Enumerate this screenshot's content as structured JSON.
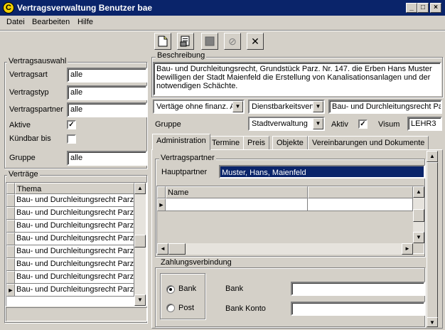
{
  "window": {
    "title": "Vertragsverwaltung Benutzer bae",
    "controls": {
      "minimize": "_",
      "maximize": "□",
      "close": "×"
    }
  },
  "menu": [
    "Datei",
    "Bearbeiten",
    "Hilfe"
  ],
  "toolbar": {
    "icons": [
      "new-document-icon",
      "save-document-icon",
      "stop-icon",
      "cancel-icon",
      "delete-icon"
    ],
    "glyph_delete": "✕",
    "glyph_cancel": "⊘"
  },
  "selection": {
    "title": "Vertragsauswahl",
    "fields": [
      {
        "label": "Vertragsart",
        "value": "alle"
      },
      {
        "label": "Vertragstyp",
        "value": "alle"
      },
      {
        "label": "Vertragspartner",
        "value": "alle"
      }
    ],
    "active_label": "Aktive",
    "active_checked": true,
    "cancelable_label": "Kündbar bis",
    "cancelable_checked": false,
    "group_label": "Gruppe",
    "group_value": "alle"
  },
  "contracts": {
    "title": "Verträge",
    "column": "Thema",
    "rows": [
      "Bau- und Durchleitungsrecht Parz.",
      "Bau- und Durchleitungsrecht Parz.",
      "Bau- und Durchleitungsrecht Parz.",
      "Bau- und Durchleitungsrecht Parz.",
      "Bau- und Durchleitungsrecht Parz.",
      "Bau- und Durchleitungsrecht Parz.",
      "Bau- und Durchleitungsrecht Parz.",
      "Bau- und Durchleitungsrecht Parz."
    ],
    "selected_index": 7
  },
  "description": {
    "title": "Beschreibung",
    "text": "Bau- und Durchleitungsrecht,  Grundstück Parz. Nr. 147. die Erben Hans Muster bewilligen der Stadt Maienfeld die Erstellung von Kanalisationsanlagen und der notwendigen Schächte."
  },
  "attributes": {
    "combo1": "Vertäge ohne finanz. A",
    "combo2": "Dienstbarkeitsvert",
    "field3": "Bau- und Durchleitungsrecht Parz.",
    "group_label": "Gruppe",
    "group_value": "Stadtverwaltung",
    "active_label": "Aktiv",
    "active_checked": true,
    "visum_label": "Visum",
    "visum_value": "LEHR3"
  },
  "tabs": [
    "Administration",
    "Termine",
    "Preis",
    "Objekte",
    "Vereinbarungen und Dokumente"
  ],
  "active_tab": 0,
  "partner": {
    "title": "Vertragspartner",
    "main_label": "Hauptpartner",
    "main_value": "Muster, Hans, Maienfeld",
    "grid_column": "Name"
  },
  "payment": {
    "title": "Zahlungsverbindung",
    "options": [
      "Bank",
      "Post"
    ],
    "selected": "Bank",
    "bank_label": "Bank",
    "account_label": "Bank Konto"
  },
  "scroll": {
    "up": "▲",
    "down": "▼",
    "left": "◄",
    "right": "►",
    "row_marker": "►"
  }
}
